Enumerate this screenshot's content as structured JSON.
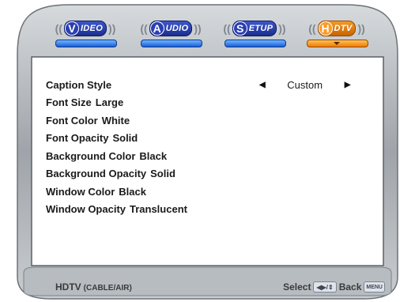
{
  "tabs": [
    {
      "letter": "V",
      "rest": "IDEO",
      "active": false
    },
    {
      "letter": "A",
      "rest": "UDIO",
      "active": false
    },
    {
      "letter": "S",
      "rest": "ETUP",
      "active": false
    },
    {
      "letter": "H",
      "rest": "DTV",
      "active": true
    }
  ],
  "tab_brackets": {
    "open": "((",
    "close": "))"
  },
  "menu": {
    "caption_style": {
      "label": "Caption Style",
      "value": "Custom",
      "left_arrow": "◀",
      "right_arrow": "▶"
    },
    "items": [
      {
        "label": "Font Size",
        "value": "Large"
      },
      {
        "label": "Font Color",
        "value": "White"
      },
      {
        "label": "Font Opacity",
        "value": "Solid"
      },
      {
        "label": "Background Color",
        "value": "Black"
      },
      {
        "label": "Background Opacity",
        "value": "Solid"
      },
      {
        "label": "Window Color",
        "value": "Black"
      },
      {
        "label": "Window Opacity",
        "value": "Translucent"
      }
    ]
  },
  "footer": {
    "source_main": "HDTV",
    "source_sub": "(CABLE/AIR)",
    "select_label": "Select",
    "select_keys": "◀▶/⇕",
    "back_label": "Back",
    "menu_key": "MENU"
  },
  "colors": {
    "frame_gray": "#a9aeb3",
    "tab_blue": "#2a3fb4",
    "tab_orange": "#f08a10"
  }
}
